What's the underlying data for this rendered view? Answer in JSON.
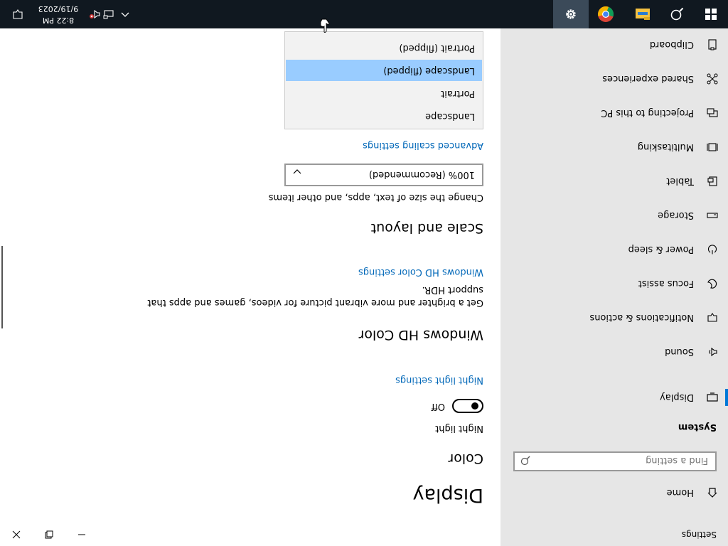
{
  "window": {
    "title": "Settings",
    "controls": {
      "minimize": "minimize",
      "maximize": "maximize",
      "close": "close"
    }
  },
  "nav": {
    "home_label": "Home",
    "search_placeholder": "Find a setting",
    "section_header": "System",
    "items": [
      {
        "label": "Display",
        "icon": "monitor-icon",
        "active": true
      },
      {
        "label": "Sound",
        "icon": "speaker-icon"
      },
      {
        "label": "Notifications & actions",
        "icon": "notification-icon"
      },
      {
        "label": "Focus assist",
        "icon": "moon-icon"
      },
      {
        "label": "Power & sleep",
        "icon": "power-icon"
      },
      {
        "label": "Storage",
        "icon": "storage-icon"
      },
      {
        "label": "Tablet",
        "icon": "tablet-icon"
      },
      {
        "label": "Multitasking",
        "icon": "multitasking-icon"
      },
      {
        "label": "Projecting to this PC",
        "icon": "projector-icon"
      },
      {
        "label": "Shared experiences",
        "icon": "shared-icon"
      },
      {
        "label": "Clipboard",
        "icon": "clipboard-icon"
      }
    ]
  },
  "content": {
    "page_title": "Display",
    "color_header": "Color",
    "night_light_label": "Night light",
    "night_light_state": "Off",
    "night_light_link": "Night light settings",
    "hdr_header": "Windows HD Color",
    "hdr_desc_1": "Get a brighter and more vibrant picture for videos, games and apps that",
    "hdr_desc_2": "support HDR.",
    "hdr_link": "Windows HD Color settings",
    "scale_header": "Scale and layout",
    "scale_desc": "Change the size of text, apps, and other items",
    "scale_value": "100% (Recommended)",
    "advanced_link": "Advanced scaling settings",
    "orientation_options": [
      "Landscape",
      "Portrait",
      "Landscape (flipped)",
      "Portrait (flipped)"
    ],
    "orientation_selected": "Landscape (flipped)"
  },
  "taskbar": {
    "time": "8:22 PM",
    "date": "9/19/2023",
    "accent": "#0078d7"
  }
}
